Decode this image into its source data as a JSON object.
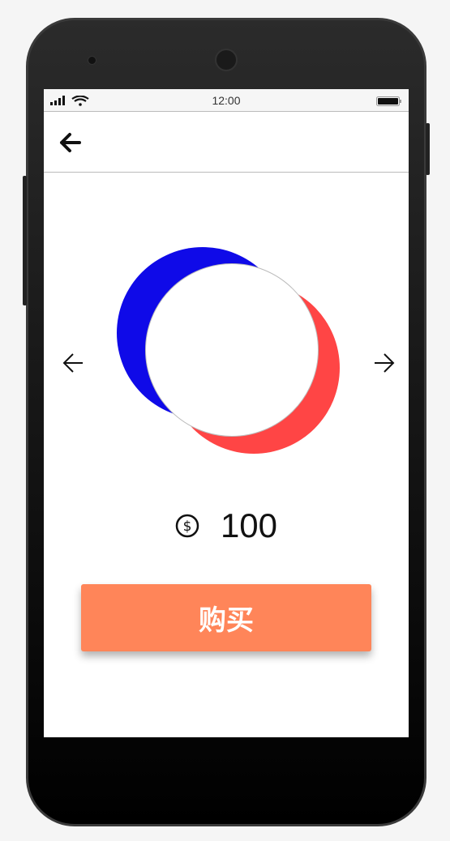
{
  "status_bar": {
    "time": "12:00"
  },
  "product": {
    "price": "100",
    "currency_icon": "dollar-circle-icon"
  },
  "buy_button": {
    "label": "购买"
  },
  "colors": {
    "blue": "#0f0ae8",
    "red": "#ff4545",
    "button": "#ff8559"
  }
}
